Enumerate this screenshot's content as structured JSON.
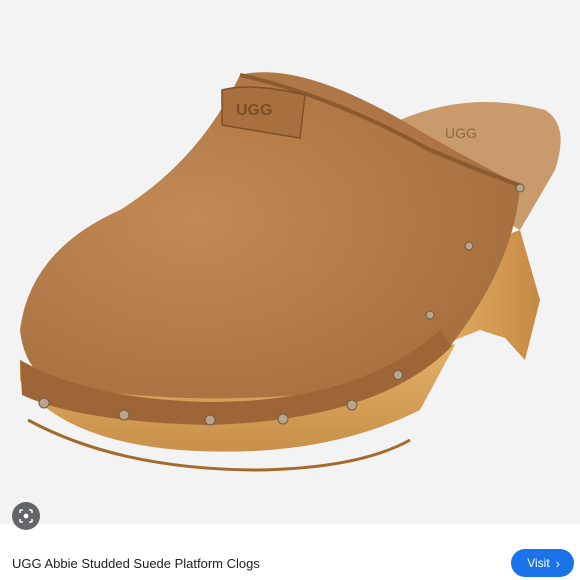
{
  "product": {
    "image_alt": "Chestnut suede clog with wooden studded platform sole",
    "brand_tab_text": "UGG",
    "insole_text": "UGG",
    "title": "UGG Abbie Studded Suede Platform Clogs"
  },
  "actions": {
    "visit_label": "Visit",
    "visit_chevron": "›"
  },
  "icons": {
    "lens": "lens-icon",
    "chevron": "chevron-right-icon"
  },
  "colors": {
    "accent": "#1a73e8",
    "suede": "#b37a45",
    "wood": "#d9a35a",
    "background": "#f3f3f3"
  }
}
